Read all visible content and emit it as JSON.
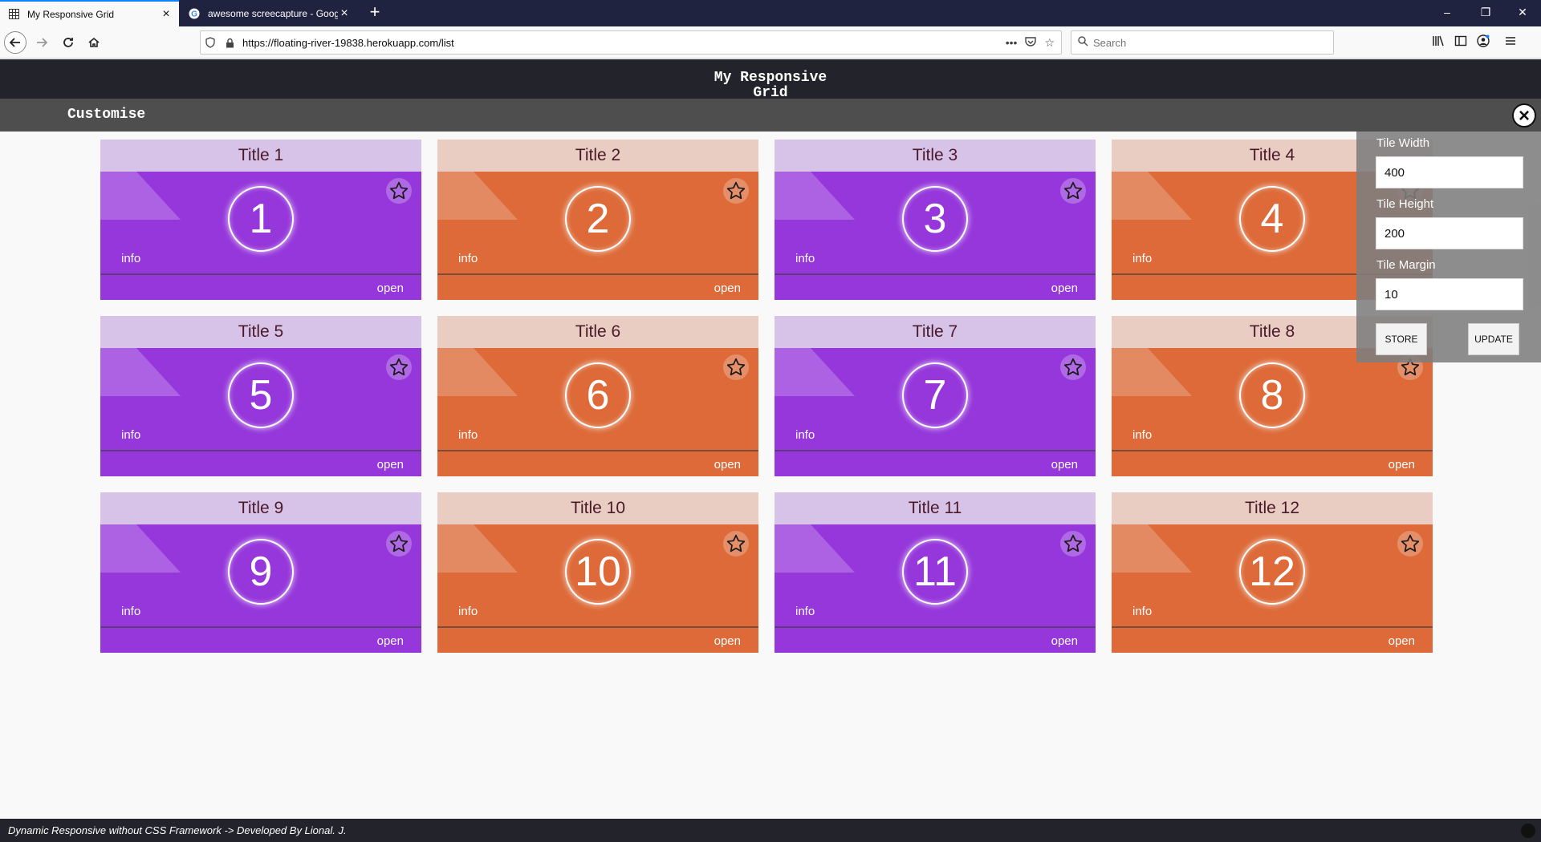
{
  "browser": {
    "tabs": [
      {
        "title": "My Responsive Grid",
        "active": true
      },
      {
        "title": "awesome screecapture - Googl",
        "active": false
      }
    ],
    "url": "https://floating-river-19838.herokuapp.com/list",
    "search_placeholder": "Search",
    "window_controls": {
      "minimize": "–",
      "restore": "❐",
      "close": "✕"
    }
  },
  "app": {
    "title_line1": "My Responsive",
    "title_line2": "Grid",
    "customise_label": "Customise"
  },
  "tiles": [
    {
      "title": "Title 1",
      "number": "1",
      "color": "purple"
    },
    {
      "title": "Title 2",
      "number": "2",
      "color": "orange"
    },
    {
      "title": "Title 3",
      "number": "3",
      "color": "purple"
    },
    {
      "title": "Title 4",
      "number": "4",
      "color": "orange"
    },
    {
      "title": "Title 5",
      "number": "5",
      "color": "purple"
    },
    {
      "title": "Title 6",
      "number": "6",
      "color": "orange"
    },
    {
      "title": "Title 7",
      "number": "7",
      "color": "purple"
    },
    {
      "title": "Title 8",
      "number": "8",
      "color": "orange"
    },
    {
      "title": "Title 9",
      "number": "9",
      "color": "purple"
    },
    {
      "title": "Title 10",
      "number": "10",
      "color": "orange"
    },
    {
      "title": "Title 11",
      "number": "11",
      "color": "purple"
    },
    {
      "title": "Title 12",
      "number": "12",
      "color": "orange"
    }
  ],
  "tile_labels": {
    "info": "info",
    "open": "open"
  },
  "colors": {
    "purple": "#9537db",
    "orange": "#dd6a38",
    "header_bg": "#23232b",
    "customise_bg": "#4e4e4e"
  },
  "panel": {
    "tile_width_label": "Tile Width",
    "tile_width_value": "400",
    "tile_height_label": "Tile Height",
    "tile_height_value": "200",
    "tile_margin_label": "Tile Margin",
    "tile_margin_value": "10",
    "store_label": "STORE",
    "update_label": "UPDATE"
  },
  "footer": {
    "text": "Dynamic Responsive without CSS Framework -> Developed By Lional. J."
  }
}
